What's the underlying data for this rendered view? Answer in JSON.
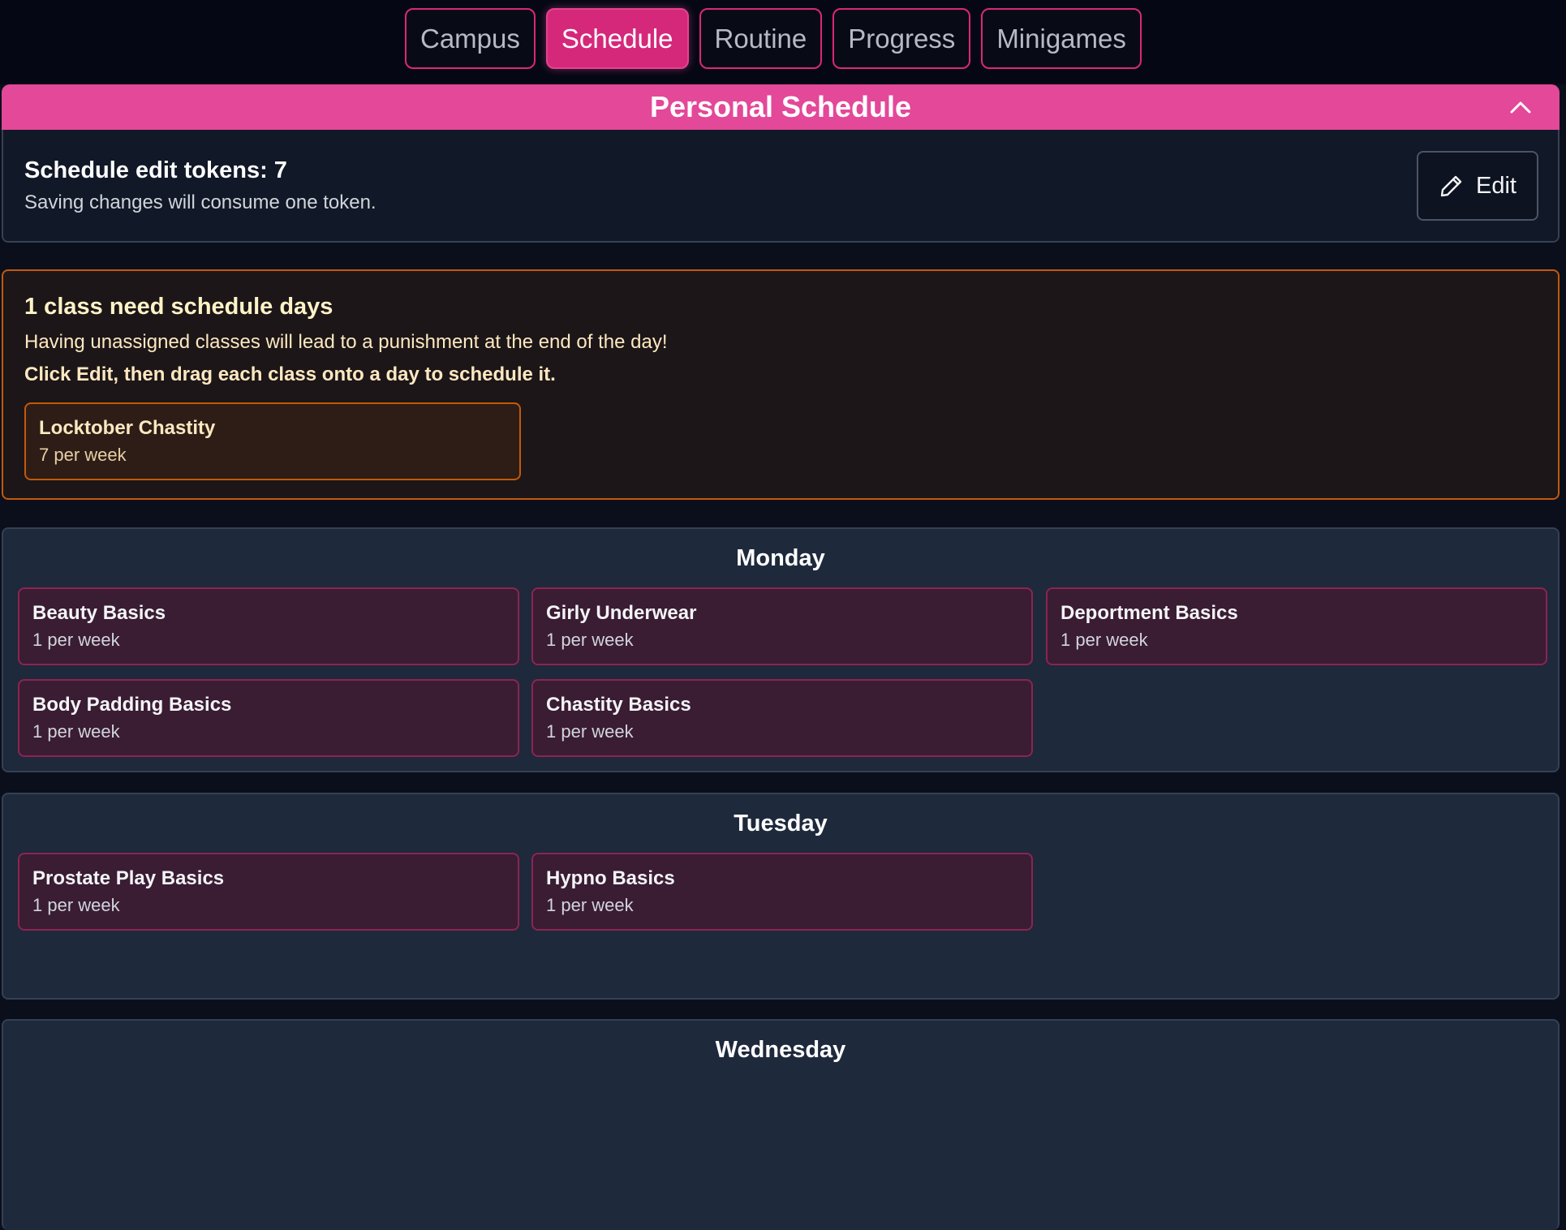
{
  "nav": {
    "tabs": [
      {
        "label": "Campus",
        "active": false
      },
      {
        "label": "Schedule",
        "active": true
      },
      {
        "label": "Routine",
        "active": false
      },
      {
        "label": "Progress",
        "active": false
      },
      {
        "label": "Minigames",
        "active": false
      }
    ]
  },
  "header": {
    "title": "Personal Schedule",
    "collapse_icon": "chevron-up-icon"
  },
  "tokens": {
    "title": "Schedule edit tokens: 7",
    "subtitle": "Saving changes will consume one token.",
    "edit_label": "Edit",
    "edit_icon": "pencil-icon"
  },
  "warning": {
    "title": "1 class need schedule days",
    "line1": "Having unassigned classes will lead to a punishment at the end of the day!",
    "line2": "Click Edit, then drag each class onto a day to schedule it.",
    "unassigned": [
      {
        "name": "Locktober Chastity",
        "freq": "7 per week"
      }
    ]
  },
  "days": [
    {
      "name": "Monday",
      "classes": [
        {
          "name": "Beauty Basics",
          "freq": "1 per week"
        },
        {
          "name": "Girly Underwear",
          "freq": "1 per week"
        },
        {
          "name": "Deportment Basics",
          "freq": "1 per week"
        },
        {
          "name": "Body Padding Basics",
          "freq": "1 per week"
        },
        {
          "name": "Chastity Basics",
          "freq": "1 per week"
        }
      ]
    },
    {
      "name": "Tuesday",
      "classes": [
        {
          "name": "Prostate Play Basics",
          "freq": "1 per week"
        },
        {
          "name": "Hypno Basics",
          "freq": "1 per week"
        }
      ]
    },
    {
      "name": "Wednesday",
      "classes": []
    }
  ],
  "colors": {
    "accent": "#e34899",
    "active_tab": "#d5287b",
    "warning_border": "#c2590c",
    "card_bg": "#3a1c33"
  }
}
